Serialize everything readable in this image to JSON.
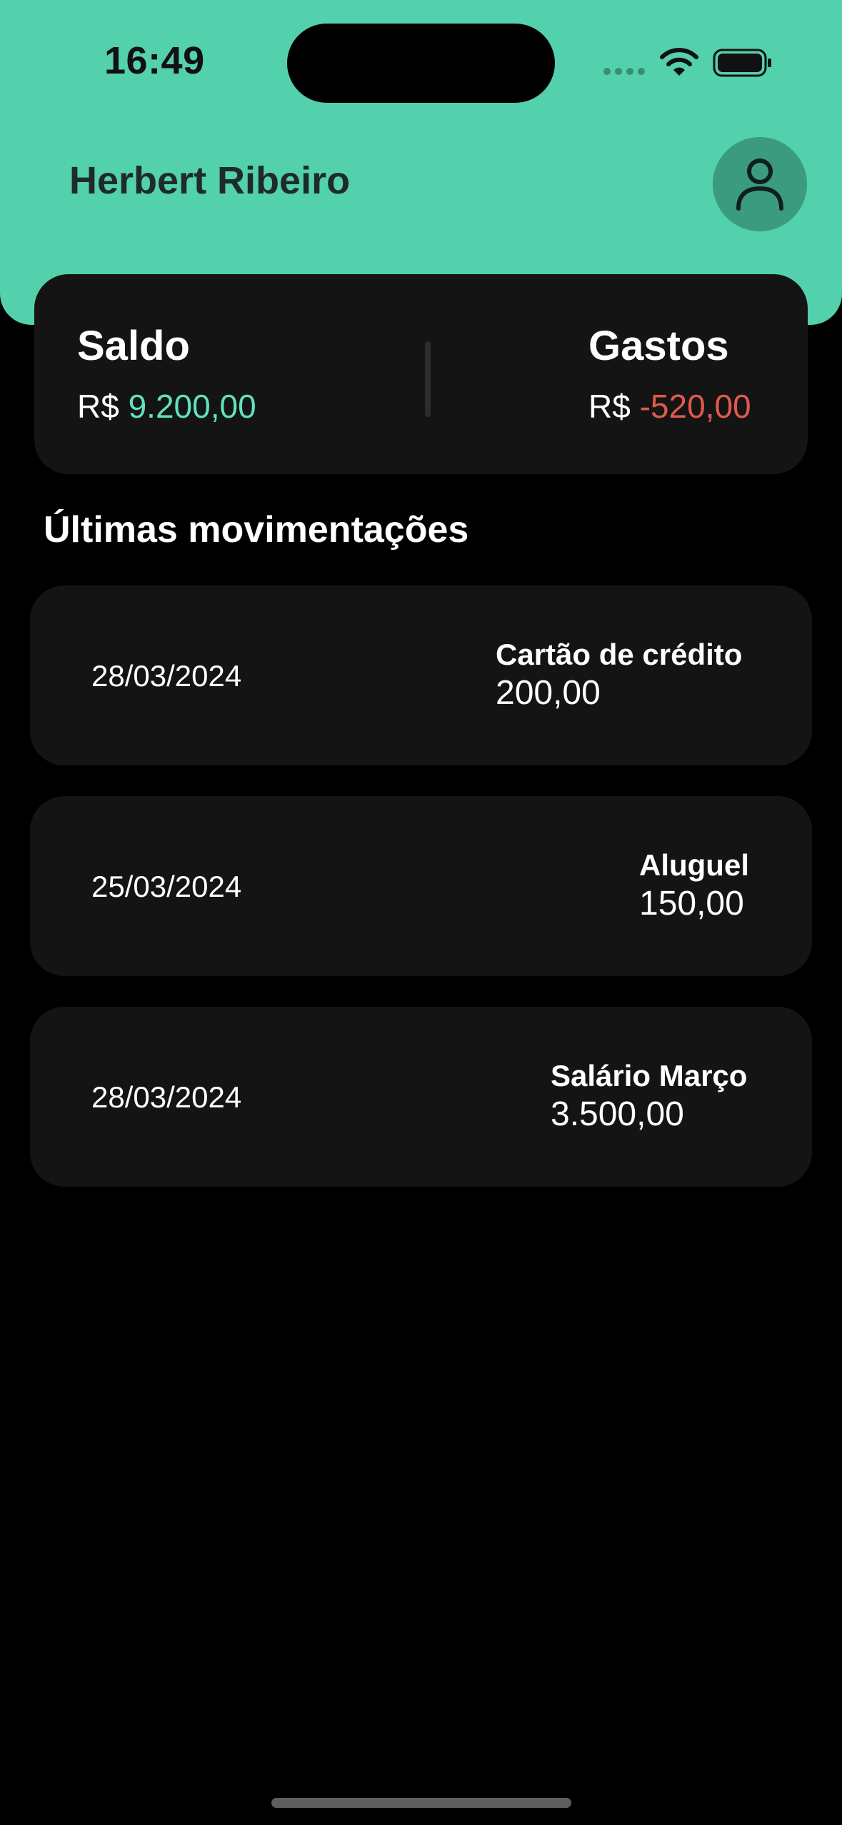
{
  "status_bar": {
    "time": "16:49",
    "icons": [
      "cellular-signal-icon",
      "wifi-icon",
      "battery-icon"
    ]
  },
  "header": {
    "user_name": "Herbert Ribeiro",
    "avatar_icon": "user-icon"
  },
  "summary": {
    "balance": {
      "title": "Saldo",
      "currency": "R$",
      "value": "9.200,00",
      "color": "#5ee3bd"
    },
    "expenses": {
      "title": "Gastos",
      "currency": "R$",
      "value": "-520,00",
      "color": "#e05a4c"
    }
  },
  "transactions": {
    "title": "Últimas movimentações",
    "items": [
      {
        "date": "28/03/2024",
        "name": "Cartão de crédito",
        "amount": "200,00"
      },
      {
        "date": "25/03/2024",
        "name": "Aluguel",
        "amount": "150,00"
      },
      {
        "date": "28/03/2024",
        "name": "Salário Março",
        "amount": "3.500,00"
      }
    ]
  },
  "colors": {
    "header_bg": "#53d0ac",
    "card_bg": "#141414",
    "background": "#000000"
  }
}
